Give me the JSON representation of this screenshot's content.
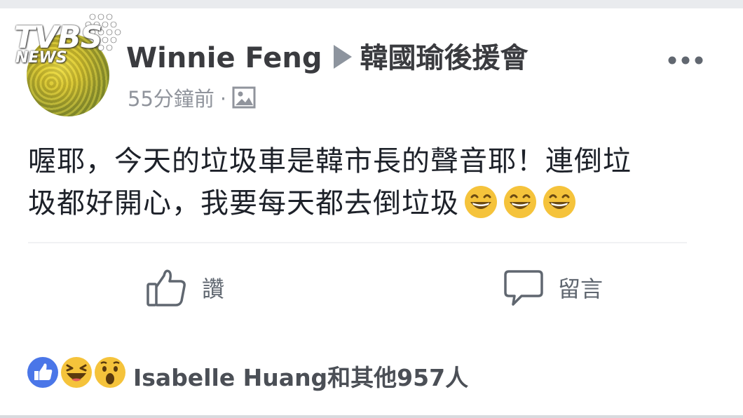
{
  "watermark": {
    "brand": "TVBS",
    "sub": "NEWS"
  },
  "post": {
    "author": "Winnie Feng",
    "group": "韓國瑜後援會",
    "timestamp": "55分鐘前",
    "separator": "·",
    "text_line1": "喔耶，今天的垃圾車是韓市長的聲音耶！連倒垃",
    "text_line2": "圾都好開心，我要每天都去倒垃圾"
  },
  "actions": {
    "like_label": "讚",
    "comment_label": "留言"
  },
  "reactions": {
    "summary": "Isabelle Huang和其他957人"
  },
  "colors": {
    "like_blue": "#4a76e8",
    "reaction_yellow": "#f5c33b",
    "meta_gray": "#90949c"
  },
  "icons": [
    "more-options-icon",
    "gallery-icon",
    "like-icon",
    "comment-icon",
    "grinning-emoji",
    "like-reaction-icon",
    "haha-reaction-icon",
    "wow-reaction-icon"
  ]
}
